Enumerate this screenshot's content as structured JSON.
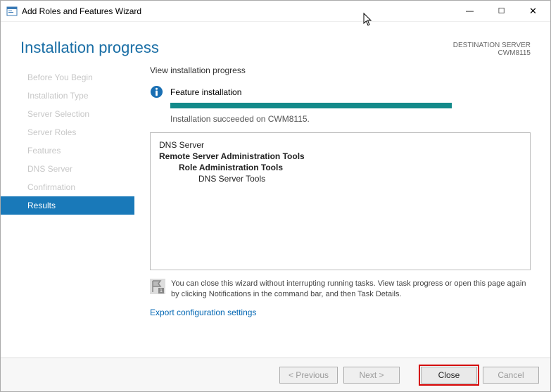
{
  "window": {
    "title": "Add Roles and Features Wizard"
  },
  "header": {
    "pageTitle": "Installation progress",
    "destLabel": "DESTINATION SERVER",
    "destServer": "CWM8115"
  },
  "sidebar": {
    "items": [
      {
        "label": "Before You Begin"
      },
      {
        "label": "Installation Type"
      },
      {
        "label": "Server Selection"
      },
      {
        "label": "Server Roles"
      },
      {
        "label": "Features"
      },
      {
        "label": "DNS Server"
      },
      {
        "label": "Confirmation"
      },
      {
        "label": "Results"
      }
    ]
  },
  "content": {
    "heading": "View installation progress",
    "featureLabel": "Feature installation",
    "statusText": "Installation succeeded on CWM8115.",
    "results": {
      "line1": "DNS Server",
      "line2": "Remote Server Administration Tools",
      "line3": "Role Administration Tools",
      "line4": "DNS Server Tools"
    },
    "note": "You can close this wizard without interrupting running tasks. View task progress or open this page again by clicking Notifications in the command bar, and then Task Details.",
    "exportLink": "Export configuration settings"
  },
  "footer": {
    "previous": "< Previous",
    "next": "Next >",
    "close": "Close",
    "cancel": "Cancel"
  }
}
